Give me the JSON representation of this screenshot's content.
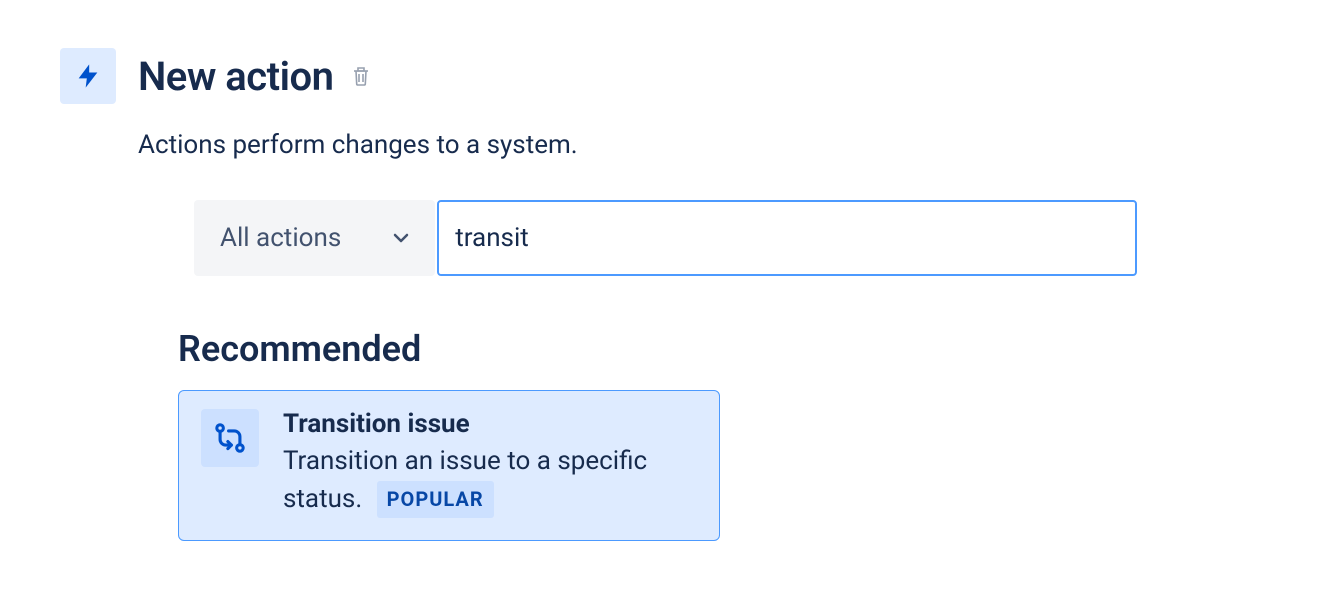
{
  "header": {
    "title": "New action",
    "subtitle": "Actions perform changes to a system."
  },
  "filter": {
    "dropdown_label": "All actions",
    "search_value": "transit"
  },
  "section_heading": "Recommended",
  "card": {
    "title": "Transition issue",
    "description": "Transition an issue to a specific status.",
    "badge": "POPULAR"
  }
}
